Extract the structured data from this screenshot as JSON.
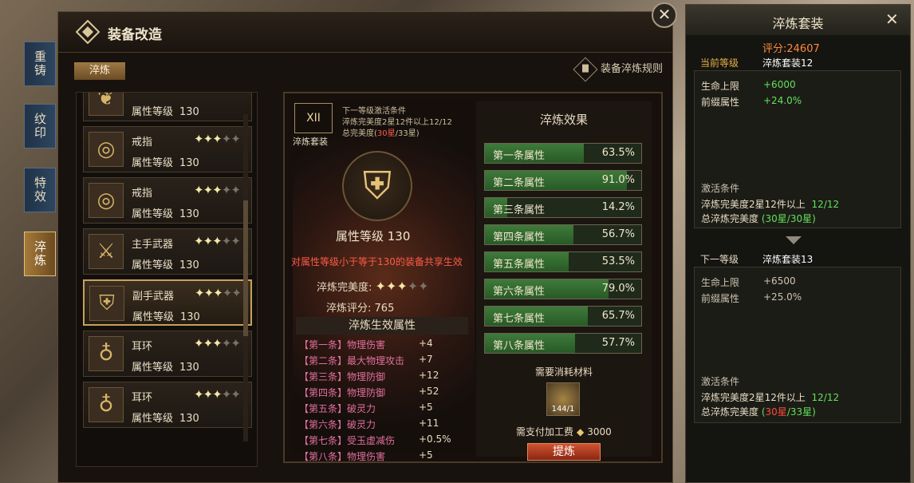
{
  "window": {
    "title": "装备改造",
    "subtab": "淬炼",
    "rules_label": "装备淬炼规则"
  },
  "side_tabs": [
    {
      "label": "重铸",
      "active": false
    },
    {
      "label": "纹印",
      "active": false
    },
    {
      "label": "特效",
      "active": false
    },
    {
      "label": "淬炼",
      "active": true
    }
  ],
  "items": [
    {
      "name": "",
      "level_label": "属性等级",
      "level": "130",
      "stars": 0,
      "max_stars": 0,
      "icon": "necklace-icon"
    },
    {
      "name": "戒指",
      "level_label": "属性等级",
      "level": "130",
      "stars": 3,
      "max_stars": 5,
      "icon": "ring-icon"
    },
    {
      "name": "戒指",
      "level_label": "属性等级",
      "level": "130",
      "stars": 3,
      "max_stars": 5,
      "icon": "ring-icon"
    },
    {
      "name": "主手武器",
      "level_label": "属性等级",
      "level": "130",
      "stars": 3,
      "max_stars": 5,
      "icon": "sword-icon"
    },
    {
      "name": "副手武器",
      "level_label": "属性等级",
      "level": "130",
      "stars": 3,
      "max_stars": 5,
      "icon": "shield-icon",
      "selected": true
    },
    {
      "name": "耳环",
      "level_label": "属性等级",
      "level": "130",
      "stars": 3,
      "max_stars": 5,
      "icon": "earring-icon"
    },
    {
      "name": "耳环",
      "level_label": "属性等级",
      "level": "130",
      "stars": 3,
      "max_stars": 5,
      "icon": "earring-icon"
    }
  ],
  "detail": {
    "set_badge": "XII",
    "set_badge_label": "淬炼套装",
    "next_title": "下一等级激活条件",
    "next_line1": "淬炼完美度2星12件以上12/12",
    "next_line2_prefix": "总完美度(",
    "next_line2_red": "30星",
    "next_line2_suffix": "/33星)",
    "attr_level": "属性等级  130",
    "shared_note": "对属性等级小于等于130的装备共享生效",
    "perfect_label": "淬炼完美度:",
    "perfect_stars": 3,
    "perfect_max": 5,
    "score_label": "淬炼评分:",
    "score_value": "765",
    "effect_title": "淬炼生效属性",
    "effects": [
      {
        "name": "【第一条】物理伤害",
        "value": "+4"
      },
      {
        "name": "【第二条】最大物理攻击",
        "value": "+7"
      },
      {
        "name": "【第三条】物理防御",
        "value": "+12"
      },
      {
        "name": "【第四条】物理防御",
        "value": "+52"
      },
      {
        "name": "【第五条】破灵力",
        "value": "+5"
      },
      {
        "name": "【第六条】破灵力",
        "value": "+11"
      },
      {
        "name": "【第七条】受玉虚减伤",
        "value": "+0.5%"
      },
      {
        "name": "【第八条】物理伤害",
        "value": "+5"
      }
    ]
  },
  "refine": {
    "title": "淬炼效果",
    "bars": [
      {
        "name": "第一条属性",
        "value": "63.5%",
        "pct": 63.5
      },
      {
        "name": "第二条属性",
        "value": "91.0%",
        "pct": 91.0
      },
      {
        "name": "第三条属性",
        "value": "14.2%",
        "pct": 14.2
      },
      {
        "name": "第四条属性",
        "value": "56.7%",
        "pct": 56.7
      },
      {
        "name": "第五条属性",
        "value": "53.5%",
        "pct": 53.5
      },
      {
        "name": "第六条属性",
        "value": "79.0%",
        "pct": 79.0
      },
      {
        "name": "第七条属性",
        "value": "65.7%",
        "pct": 65.7
      },
      {
        "name": "第八条属性",
        "value": "57.7%",
        "pct": 57.7
      }
    ],
    "material_label": "需要消耗材料",
    "material_count": "144/1",
    "fee_label": "需支付加工费",
    "fee_value": "3000",
    "button": "提炼"
  },
  "set_panel": {
    "title": "淬炼套装",
    "score": "评分:24607",
    "current_label": "当前等级",
    "current_set": "淬炼套装12",
    "current_attrs": [
      {
        "name": "生命上限",
        "value": "+6000"
      },
      {
        "name": "前缀属性",
        "value": "+24.0%"
      }
    ],
    "activate_label": "激活条件",
    "current_cond1": "淬炼完美度2星12件以上",
    "current_cond1_val": "12/12",
    "current_cond2": "总淬炼完美度",
    "current_cond2_val": "(30星/30星)",
    "next_label": "下一等级",
    "next_set": "淬炼套装13",
    "next_attrs": [
      {
        "name": "生命上限",
        "value": "+6500"
      },
      {
        "name": "前缀属性",
        "value": "+25.0%"
      }
    ],
    "next_cond1": "淬炼完美度2星12件以上",
    "next_cond1_val": "12/12",
    "next_cond2": "总淬炼完美度",
    "next_cond2_open": "(",
    "next_cond2_red": "30星",
    "next_cond2_close": "/33星)"
  }
}
